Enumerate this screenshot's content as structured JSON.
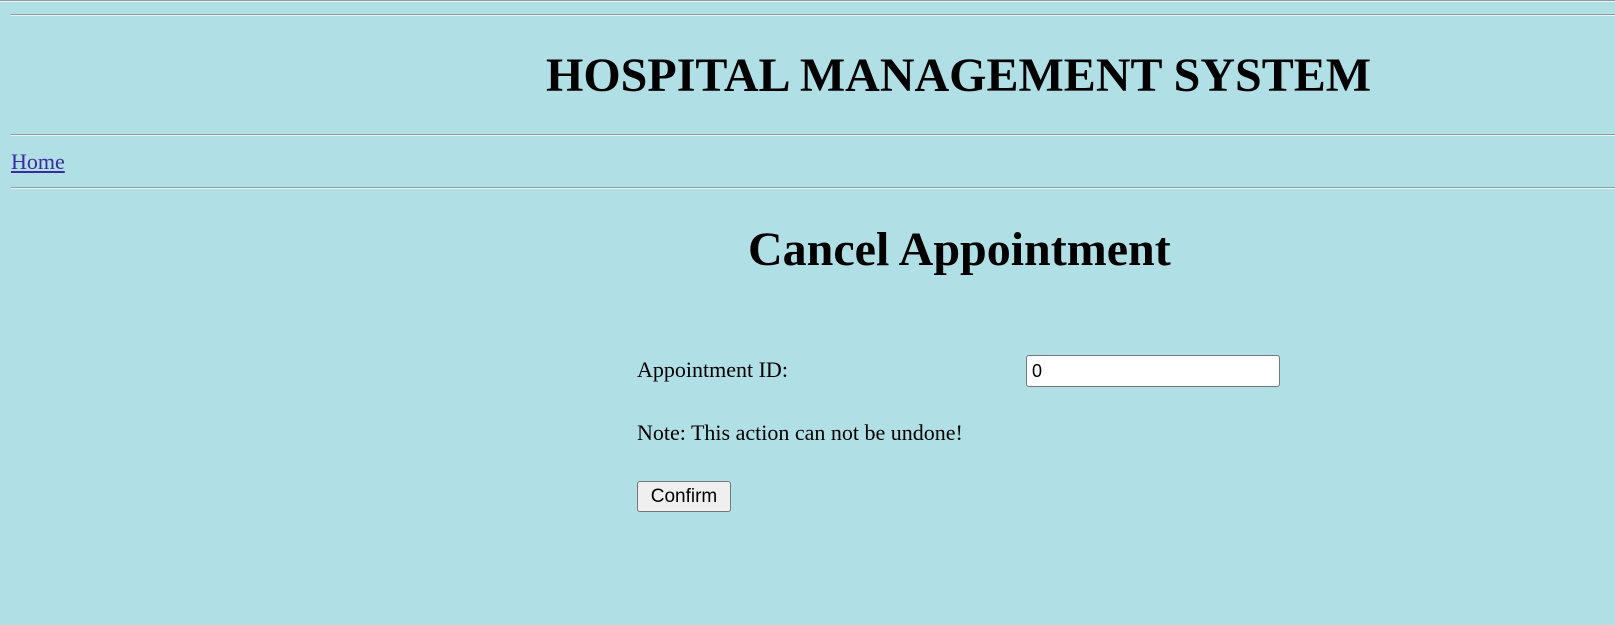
{
  "header": {
    "title": "HOSPITAL MANAGEMENT SYSTEM"
  },
  "nav": {
    "home_label": "Home"
  },
  "main": {
    "heading": "Cancel Appointment",
    "appointment_id_label": "Appointment ID:",
    "appointment_id_value": "0",
    "note": "Note: This action can not be undone!",
    "confirm_label": "Confirm"
  },
  "colors": {
    "background": "#b0dfe5",
    "link": "#3b2aa0"
  }
}
